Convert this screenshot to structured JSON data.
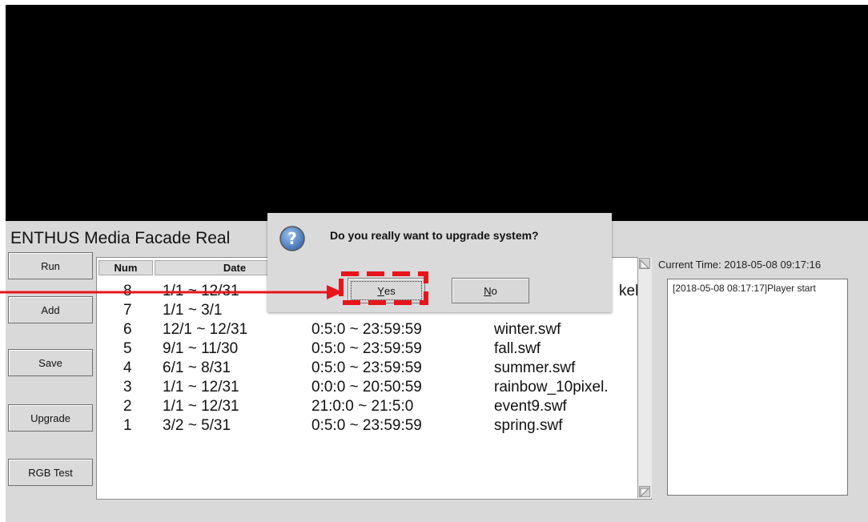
{
  "app": {
    "title": "ENTHUS Media Facade Real",
    "buttons": {
      "run": "Run",
      "add": "Add",
      "save": "Save",
      "upgrade": "Upgrade",
      "rgb_test": "RGB Test"
    },
    "current_time": "Current Time: 2018-05-08 09:17:16",
    "log_text": "[2018-05-08 08:17:17]Player start"
  },
  "schedule": {
    "columns": [
      "Num",
      "Date"
    ],
    "rows": [
      {
        "num": "8",
        "date": "1/1 ~ 12/31",
        "time": "",
        "file": "kel."
      },
      {
        "num": "7",
        "date": "1/1 ~ 3/1",
        "time": "",
        "file": ""
      },
      {
        "num": "6",
        "date": "12/1 ~ 12/31",
        "time": "0:5:0 ~ 23:59:59",
        "file": "winter.swf"
      },
      {
        "num": "5",
        "date": "9/1 ~ 11/30",
        "time": "0:5:0 ~ 23:59:59",
        "file": "fall.swf"
      },
      {
        "num": "4",
        "date": "6/1 ~ 8/31",
        "time": "0:5:0 ~ 23:59:59",
        "file": "summer.swf"
      },
      {
        "num": "3",
        "date": "1/1 ~ 12/31",
        "time": "0:0:0 ~ 20:50:59",
        "file": "rainbow_10pixel."
      },
      {
        "num": "2",
        "date": "1/1 ~ 12/31",
        "time": "21:0:0 ~ 21:5:0",
        "file": "event9.swf"
      },
      {
        "num": "1",
        "date": "3/2 ~ 5/31",
        "time": "0:5:0 ~ 23:59:59",
        "file": "spring.swf"
      }
    ]
  },
  "dialog": {
    "message": "Do you really want to upgrade system?",
    "yes_key": "Y",
    "yes_rest": "es",
    "no_key": "N",
    "no_rest": "o",
    "icon": "question-icon"
  },
  "colors": {
    "annotation": "#e8141c",
    "video_bg": "#000000",
    "panel_bg": "#d9d9d9"
  }
}
